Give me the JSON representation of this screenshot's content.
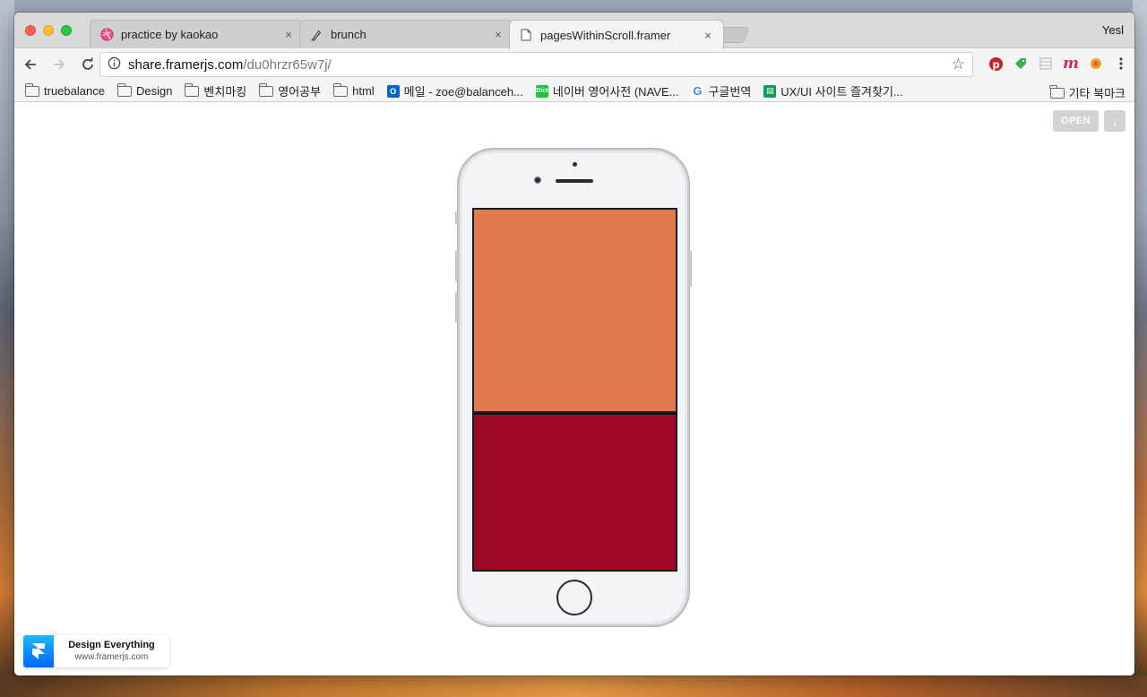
{
  "browser": {
    "profile_name": "Yesl",
    "tabs": [
      {
        "title": "practice by kaokao",
        "favicon": "dribbble-icon",
        "active": false
      },
      {
        "title": "brunch",
        "favicon": "brunch-pen-icon",
        "active": false
      },
      {
        "title": "pagesWithinScroll.framer",
        "favicon": "document-icon",
        "active": true
      }
    ],
    "tab_close_glyph": "×",
    "url": {
      "host": "share.framerjs.com",
      "path": "/du0hrzr65w7j/"
    },
    "bookmarks": [
      {
        "label": "truebalance",
        "type": "folder"
      },
      {
        "label": "Design",
        "type": "folder"
      },
      {
        "label": "벤치마킹",
        "type": "folder"
      },
      {
        "label": "영어공부",
        "type": "folder"
      },
      {
        "label": "html",
        "type": "folder"
      },
      {
        "label": "메일 - zoe@balanceh...",
        "type": "outlook-icon"
      },
      {
        "label": "네이버 영어사전 (NAVE...",
        "type": "naver-dict-icon"
      },
      {
        "label": "구글번역",
        "type": "google-icon"
      },
      {
        "label": "UX/UI 사이트 즐겨찾기...",
        "type": "sheets-icon"
      }
    ],
    "other_bookmarks": "기타 북마크"
  },
  "page": {
    "open_label": "OPEN",
    "download_glyph": "↓",
    "prototype_pages": [
      {
        "color": "#E17A4C"
      },
      {
        "color": "#9E0927"
      }
    ],
    "badge": {
      "title": "Design Everything",
      "subtitle": "www.framerjs.com"
    }
  }
}
